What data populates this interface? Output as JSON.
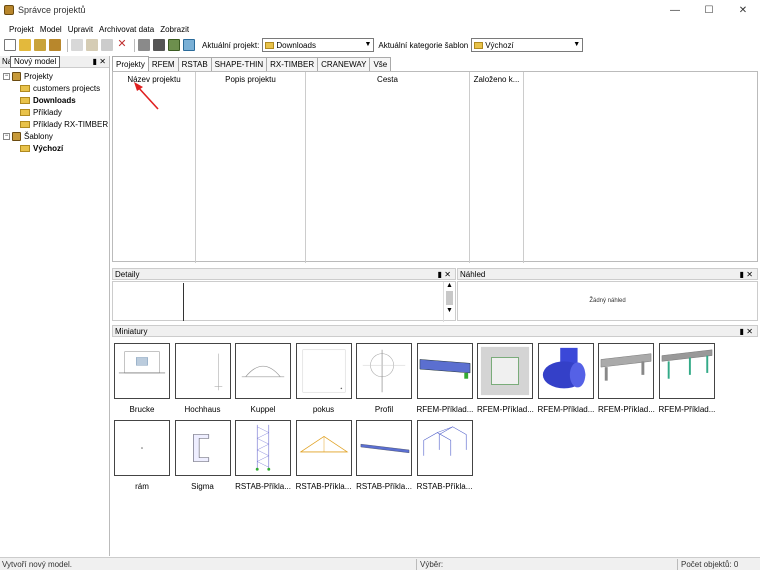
{
  "window": {
    "title": "Správce projektů"
  },
  "menu": [
    "Projekt",
    "Model",
    "Upravit",
    "Archivovat data",
    "Zobrazit"
  ],
  "toolbar": {
    "current_project_label": "Aktuální projekt:",
    "current_project_value": "Downloads",
    "template_category_label": "Aktuální kategorie šablon",
    "template_category_value": "Výchozí"
  },
  "tooltip": "Nový model",
  "sidebar": {
    "header": "Na",
    "header_suffix": "tů",
    "tree": [
      {
        "label": "Projekty",
        "level": 0,
        "bold": false,
        "kind": "root"
      },
      {
        "label": "customers projects",
        "level": 1,
        "bold": false,
        "kind": "folder"
      },
      {
        "label": "Downloads",
        "level": 1,
        "bold": true,
        "kind": "folder"
      },
      {
        "label": "Příklady",
        "level": 1,
        "bold": false,
        "kind": "folder"
      },
      {
        "label": "Příklady RX-TIMBER",
        "level": 1,
        "bold": false,
        "kind": "folder"
      },
      {
        "label": "Šablony",
        "level": 0,
        "bold": false,
        "kind": "root"
      },
      {
        "label": "Výchozí",
        "level": 1,
        "bold": true,
        "kind": "folder"
      }
    ]
  },
  "tabs": [
    "Projekty",
    "RFEM",
    "RSTAB",
    "SHAPE-THIN",
    "RX-TIMBER",
    "CRANEWAY",
    "Vše"
  ],
  "grid": {
    "columns": [
      "Název projektu",
      "Popis projektu",
      "Cesta",
      "Založeno k..."
    ]
  },
  "panels": {
    "details": "Detaily",
    "preview": "Náhled",
    "preview_empty": "Žádný náhled",
    "thumbnails": "Miniatury"
  },
  "thumbnails": [
    {
      "label": "Brucke"
    },
    {
      "label": "Hochhaus"
    },
    {
      "label": "Kuppel"
    },
    {
      "label": "pokus"
    },
    {
      "label": "Profil"
    },
    {
      "label": "RFEM-Příklad..."
    },
    {
      "label": "RFEM-Příklad..."
    },
    {
      "label": "RFEM-Příklad..."
    },
    {
      "label": "RFEM-Příklad..."
    },
    {
      "label": "RFEM-Příklad..."
    },
    {
      "label": "rám"
    },
    {
      "label": "Sigma"
    },
    {
      "label": "RSTAB-Příkla..."
    },
    {
      "label": "RSTAB-Příkla..."
    },
    {
      "label": "RSTAB-Příkla..."
    },
    {
      "label": "RSTAB-Příkla..."
    }
  ],
  "status": {
    "message": "Vytvoří nový model.",
    "selection": "Výběr:",
    "count": "Počet objektů: 0"
  }
}
